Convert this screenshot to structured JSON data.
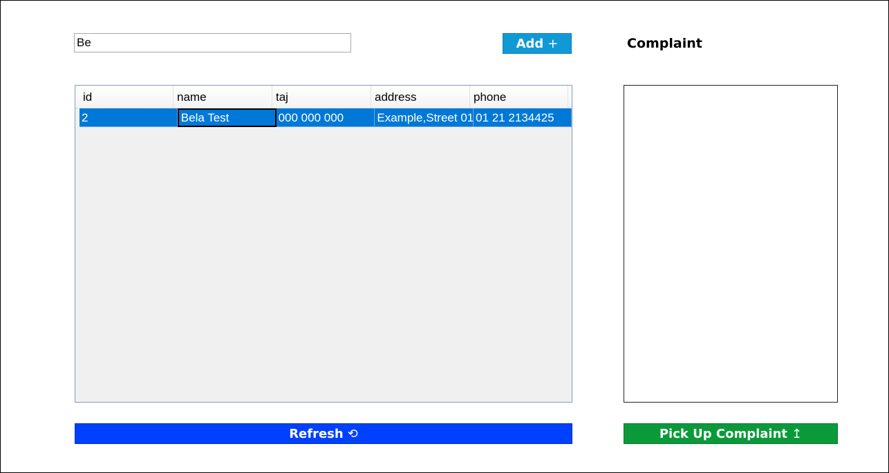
{
  "search": {
    "value": "Be"
  },
  "toolbar": {
    "add_label": "Add",
    "add_glyph": "+"
  },
  "complaint": {
    "title": "Complaint",
    "text": ""
  },
  "table": {
    "columns": [
      "id",
      "name",
      "taj",
      "address",
      "phone"
    ],
    "rows": [
      {
        "id": "2",
        "name": "Bela Test",
        "taj": "000 000 000",
        "address": "Example,Street 01",
        "phone": "01 21 2134425"
      }
    ]
  },
  "actions": {
    "refresh_label": "Refresh",
    "refresh_glyph": "⟲",
    "pickup_label": "Pick Up Complaint",
    "pickup_glyph": "↥"
  },
  "colors": {
    "add": "#1199d6",
    "refresh": "#0040ff",
    "pickup": "#0a9a3a",
    "selection": "#0078d7"
  }
}
